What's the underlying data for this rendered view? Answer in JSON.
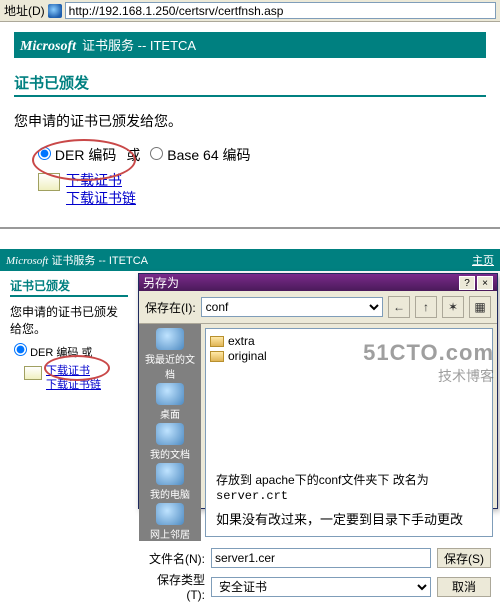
{
  "addrbar": {
    "label": "地址(D)",
    "url": "http://192.168.1.250/certsrv/certfnsh.asp"
  },
  "page": {
    "ms": "Microsoft",
    "header_rest": "证书服务  --  ITETCA",
    "issued_title": "证书已颁发",
    "issued_msg": "您申请的证书已颁发给您。",
    "enc": {
      "der": "DER 编码",
      "or": "或",
      "b64": "Base 64 编码"
    },
    "dl": {
      "cert": "下载证书",
      "chain": "下载证书链"
    }
  },
  "small": {
    "header": "证书服务 -- ITETCA",
    "home_link": "主页"
  },
  "saveas": {
    "title": "另存为",
    "save_in_lbl": "保存在(I):",
    "save_in_val": "conf",
    "places": [
      "我最近的文档",
      "桌面",
      "我的文档",
      "我的电脑",
      "网上邻居"
    ],
    "folders": [
      "extra",
      "original"
    ],
    "note1_pre": "存放到   apache下的conf文件夹下   改名为",
    "note1_name": "server.crt",
    "note2": "如果没有改过来，一定要到目录下手动更改",
    "filename_lbl": "文件名(N):",
    "filename_val": "server1.cer",
    "filetype_lbl": "保存类型(T):",
    "filetype_val": "安全证书",
    "btn_save": "保存(S)",
    "btn_cancel": "取消"
  },
  "wm": {
    "l1": "51CTO.com",
    "l2": "技术博客"
  }
}
